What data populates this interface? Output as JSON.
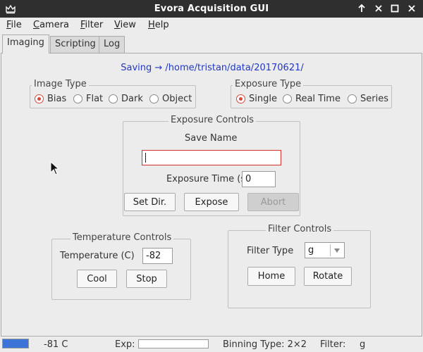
{
  "window": {
    "title": "Evora Acquisition GUI",
    "app_icon": "crown-icon",
    "controls": [
      "arrow-up-icon",
      "close-x-icon",
      "maximize-square-icon",
      "close-x-icon"
    ]
  },
  "menu": {
    "items": [
      {
        "mnemonic": "F",
        "rest": "ile"
      },
      {
        "mnemonic": "C",
        "rest": "amera"
      },
      {
        "mnemonic": "F",
        "rest": "ilter"
      },
      {
        "mnemonic": "V",
        "rest": "iew"
      },
      {
        "mnemonic": "H",
        "rest": "elp"
      }
    ]
  },
  "tabs": [
    {
      "label": "Imaging",
      "active": true
    },
    {
      "label": "Scripting",
      "active": false
    },
    {
      "label": "Log",
      "active": false
    }
  ],
  "saving_text": "Saving → /home/tristan/data/20170621/",
  "image_type": {
    "title": "Image Type",
    "options": [
      {
        "label": "Bias",
        "checked": true
      },
      {
        "label": "Flat",
        "checked": false
      },
      {
        "label": "Dark",
        "checked": false
      },
      {
        "label": "Object",
        "checked": false
      }
    ]
  },
  "exposure_type": {
    "title": "Exposure Type",
    "options": [
      {
        "label": "Single",
        "checked": true
      },
      {
        "label": "Real Time",
        "checked": false
      },
      {
        "label": "Series",
        "checked": false
      }
    ]
  },
  "exposure_controls": {
    "title": "Exposure Controls",
    "save_name_label": "Save Name",
    "save_name_value": "",
    "exposure_time_label": "Exposure Time (s)",
    "exposure_time_value": "0",
    "set_dir_label": "Set Dir.",
    "expose_label": "Expose",
    "abort_label": "Abort"
  },
  "temperature_controls": {
    "title": "Temperature Controls",
    "temperature_label": "Temperature (C)",
    "temperature_value": "-82",
    "cool_label": "Cool",
    "stop_label": "Stop"
  },
  "filter_controls": {
    "title": "Filter Controls",
    "filter_type_label": "Filter Type",
    "filter_value": "g",
    "home_label": "Home",
    "rotate_label": "Rotate"
  },
  "status": {
    "progress_fraction": 1.0,
    "temperature": "-81 C",
    "exp_label": "Exp:",
    "exp_progress_fraction": 0.0,
    "binning": "Binning Type: 2×2",
    "filter_label": "Filter:",
    "filter_value": "g"
  },
  "colors": {
    "accent_radio": "#d94a3a",
    "saving_text": "#2237c6",
    "progress_fill": "#3b73d6",
    "error_border": "#d32f2f"
  }
}
